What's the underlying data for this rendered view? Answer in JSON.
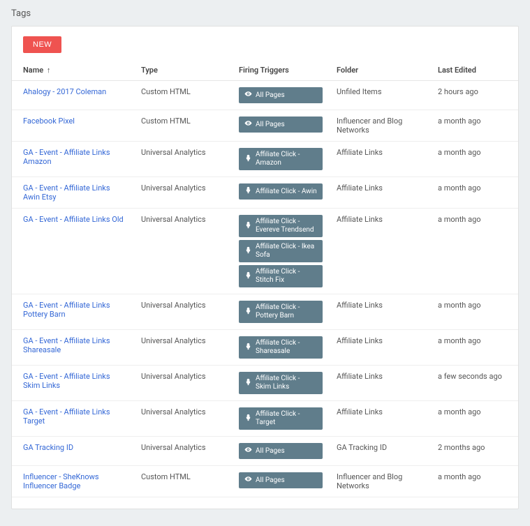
{
  "page_title": "Tags",
  "toolbar": {
    "new_label": "NEW"
  },
  "columns": {
    "name": "Name",
    "type": "Type",
    "triggers": "Firing Triggers",
    "folder": "Folder",
    "edited": "Last Edited"
  },
  "sort_indicator": "↑",
  "rows": [
    {
      "name": "Ahalogy - 2017 Coleman",
      "type": "Custom HTML",
      "triggers": [
        {
          "icon": "eye",
          "label": "All Pages"
        }
      ],
      "folder": "Unfiled Items",
      "edited": "2 hours ago"
    },
    {
      "name": "Facebook Pixel",
      "type": "Custom HTML",
      "triggers": [
        {
          "icon": "eye",
          "label": "All Pages"
        }
      ],
      "folder": "Influencer and Blog Networks",
      "edited": "a month ago"
    },
    {
      "name": "GA - Event - Affiliate Links Amazon",
      "type": "Universal Analytics",
      "triggers": [
        {
          "icon": "click",
          "label": "Affiliate Click - Amazon"
        }
      ],
      "folder": "Affiliate Links",
      "edited": "a month ago"
    },
    {
      "name": "GA - Event - Affiliate Links Awin Etsy",
      "type": "Universal Analytics",
      "triggers": [
        {
          "icon": "click",
          "label": "Affiliate Click - Awin"
        }
      ],
      "folder": "Affiliate Links",
      "edited": "a month ago"
    },
    {
      "name": "GA - Event - Affiliate Links Old",
      "type": "Universal Analytics",
      "triggers": [
        {
          "icon": "click",
          "label": "Affiliate Click - Evereve Trendsend"
        },
        {
          "icon": "click",
          "label": "Affiliate Click - Ikea Sofa"
        },
        {
          "icon": "click",
          "label": "Affiliate Click - Stitch Fix"
        }
      ],
      "folder": "Affiliate Links",
      "edited": "a month ago"
    },
    {
      "name": "GA - Event - Affiliate Links Pottery Barn",
      "type": "Universal Analytics",
      "triggers": [
        {
          "icon": "click",
          "label": "Affiliate Click - Pottery Barn"
        }
      ],
      "folder": "Affiliate Links",
      "edited": "a month ago"
    },
    {
      "name": "GA - Event - Affiliate Links Shareasale",
      "type": "Universal Analytics",
      "triggers": [
        {
          "icon": "click",
          "label": "Affiliate Click - Shareasale"
        }
      ],
      "folder": "Affiliate Links",
      "edited": "a month ago"
    },
    {
      "name": "GA - Event - Affiliate Links Skim Links",
      "type": "Universal Analytics",
      "triggers": [
        {
          "icon": "click",
          "label": "Affiliate Click - Skim Links"
        }
      ],
      "folder": "Affiliate Links",
      "edited": "a few seconds ago"
    },
    {
      "name": "GA - Event - Affiliate Links Target",
      "type": "Universal Analytics",
      "triggers": [
        {
          "icon": "click",
          "label": "Affiliate Click - Target"
        }
      ],
      "folder": "Affiliate Links",
      "edited": "a month ago"
    },
    {
      "name": "GA Tracking ID",
      "type": "Universal Analytics",
      "triggers": [
        {
          "icon": "eye",
          "label": "All Pages"
        }
      ],
      "folder": "GA Tracking ID",
      "edited": "2 months ago"
    },
    {
      "name": "Influencer - SheKnows Influencer Badge",
      "type": "Custom HTML",
      "triggers": [
        {
          "icon": "eye",
          "label": "All Pages"
        }
      ],
      "folder": "Influencer and Blog Networks",
      "edited": "a month ago"
    }
  ]
}
